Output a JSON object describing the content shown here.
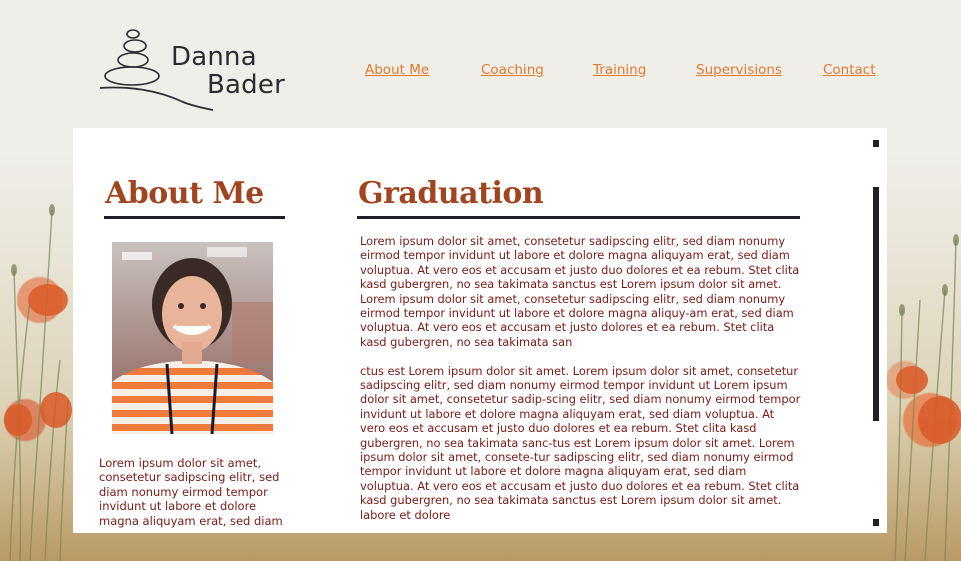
{
  "brand": {
    "line1": "Danna",
    "line2": "Bader"
  },
  "nav": {
    "items": [
      {
        "label": "About Me"
      },
      {
        "label": "Coaching"
      },
      {
        "label": "Training"
      },
      {
        "label": "Supervisions"
      },
      {
        "label": "Contact"
      }
    ]
  },
  "sidebar": {
    "heading": "About Me",
    "text": "Lorem ipsum dolor sit amet, consetetur sadipscing elitr, sed diam nonumy eirmod tempor invidunt ut labore et dolore magna aliquyam erat, sed diam"
  },
  "main": {
    "heading": "Graduation",
    "paragraphs": [
      "Lorem ipsum dolor sit amet, consetetur sadipscing elitr, sed diam nonumy eirmod tempor invidunt ut labore et dolore magna aliquyam erat, sed diam voluptua. At vero eos et accusam et justo duo dolores et ea rebum. Stet clita kasd gubergren, no sea takimata sanctus est Lorem ipsum dolor sit amet. Lorem ipsum dolor sit amet, consetetur sadipscing elitr, sed diam nonumy eirmod tempor invidunt ut labore et dolore magna aliquy-am erat, sed diam voluptua. At vero eos et accusam et justo dolores et ea rebum. Stet clita kasd gubergren, no sea takimata san",
      "ctus est Lorem ipsum dolor sit amet. Lorem ipsum dolor sit amet, consetetur sadipscing elitr, sed diam nonumy eirmod tempor invidunt ut Lorem ipsum dolor sit amet, consetetur sadip-scing elitr, sed diam nonumy eirmod tempor invidunt ut labore et dolore magna aliquyam erat, sed diam voluptua. At vero eos et accusam et justo duo dolores et ea rebum. Stet clita kasd gubergren, no sea takimata sanc-tus est Lorem ipsum dolor sit amet. Lorem ipsum dolor sit amet, consete-tur sadipscing elitr, sed diam nonumy eirmod tempor invidunt ut labore et dolore magna aliquyam erat, sed diam voluptua. At vero eos et accusam et justo duo dolores et ea rebum. Stet clita kasd gubergren, no sea takimata sanctus est Lorem ipsum dolor sit amet. labore et dolore"
    ]
  },
  "colors": {
    "accent": "#a0451f",
    "nav_link": "#e07a2c",
    "body_text": "#7a1a14",
    "rule": "#231f2a",
    "panel": "#ffffff"
  }
}
